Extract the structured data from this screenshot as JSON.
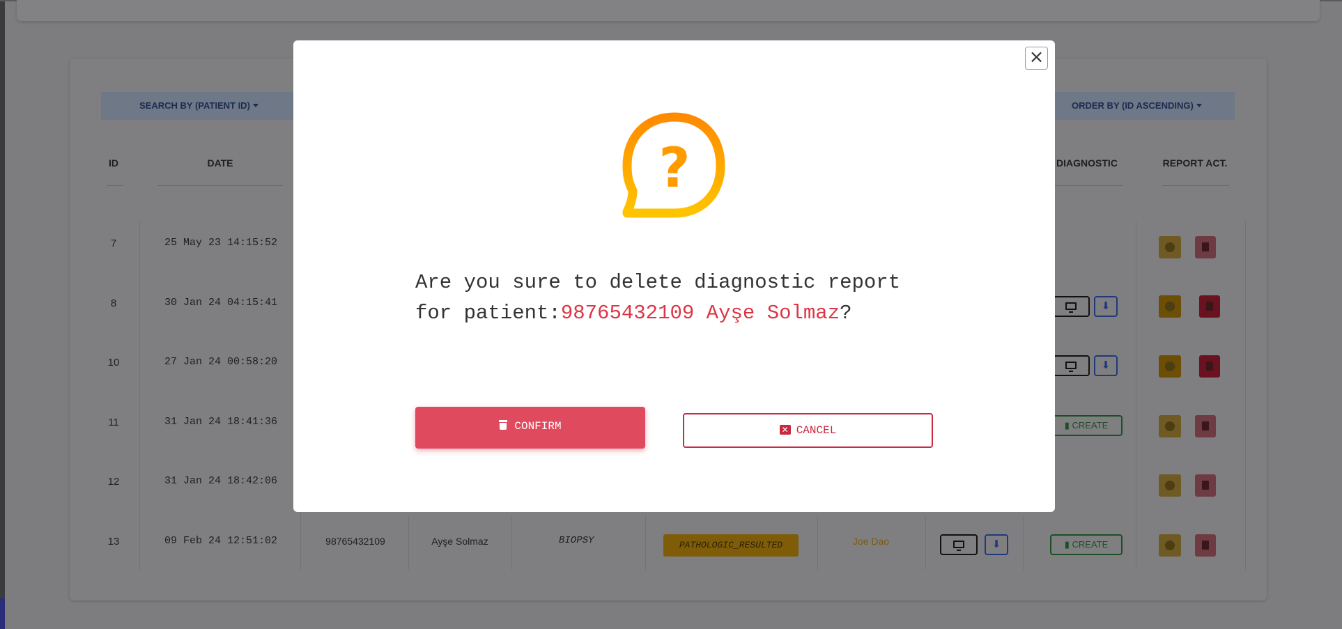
{
  "background": {
    "filters": {
      "search_by": "SEARCH BY (PATIENT ID)",
      "order_by": "ORDER BY (ID ASCENDING)"
    },
    "columns": {
      "id": "ID",
      "date": "DATE",
      "diagnostic": "DIAGNOSTIC",
      "report_act": "REPORT ACT."
    },
    "rows": [
      {
        "id": "7",
        "date": "25 May 23 14:15:52"
      },
      {
        "id": "8",
        "date": "30 Jan 24 04:15:41"
      },
      {
        "id": "10",
        "date": "27 Jan 24 00:58:20"
      },
      {
        "id": "11",
        "date": "31 Jan 24 18:41:36"
      },
      {
        "id": "12",
        "date": "31 Jan 24 18:42:06"
      },
      {
        "id": "13",
        "date": "09 Feb 24 12:51:02",
        "patient_id": "98765432109",
        "patient_name": "Ayşe Solmaz",
        "specimen": "BIOPSY",
        "status": "PATHOLOGIC_RESULTED",
        "doctor": "Joe Dao"
      }
    ],
    "create_label": "CREATE",
    "colors": {
      "status_badge": "#ffc107",
      "create": "#28a745",
      "danger": "#dc3545"
    }
  },
  "modal": {
    "close_glyph": "×",
    "question_mark": "?",
    "message_prefix": "Are you sure to delete diagnostic report for patient:",
    "patient_highlight": "98765432109 Ayşe Solmaz",
    "message_suffix": "?",
    "confirm_label": "CONFIRM",
    "cancel_label": "CANCEL",
    "colors": {
      "icon_gradient_top": "#ff8a00",
      "icon_gradient_bottom": "#ffc400",
      "highlight": "#dc3545",
      "confirm_bg": "#e04a5f"
    }
  }
}
